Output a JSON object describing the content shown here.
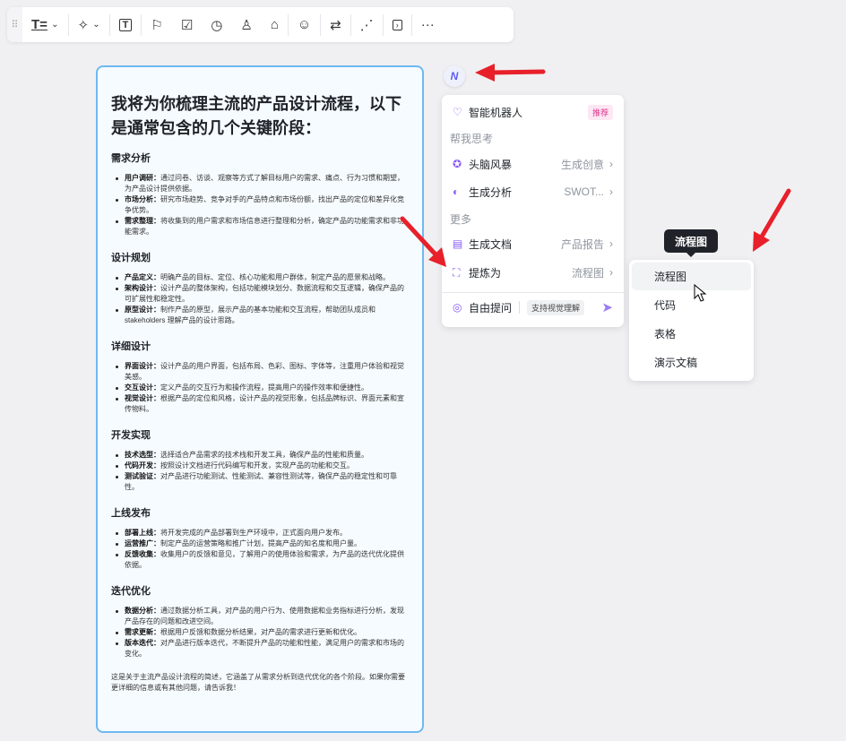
{
  "toolbar": {
    "icons": [
      "drag-handle",
      "text-style",
      "ai-magic",
      "text-box",
      "flag",
      "checkbox",
      "clock",
      "user",
      "tag",
      "emoji-add",
      "convert",
      "mindmap",
      "panel",
      "more"
    ]
  },
  "doc": {
    "title": "我将为你梳理主流的产品设计流程，以下是通常包含的几个关键阶段：",
    "sections": [
      {
        "heading": "需求分析",
        "items": [
          {
            "term": "用户调研：",
            "text": "通过问卷、访谈、观察等方式了解目标用户的需求、痛点、行为习惯和期望，为产品设计提供依据。"
          },
          {
            "term": "市场分析：",
            "text": "研究市场趋势、竞争对手的产品特点和市场份额，找出产品的定位和差异化竞争优势。"
          },
          {
            "term": "需求整理：",
            "text": "将收集到的用户需求和市场信息进行整理和分析，确定产品的功能需求和非功能需求。"
          }
        ]
      },
      {
        "heading": "设计规划",
        "items": [
          {
            "term": "产品定义：",
            "text": "明确产品的目标、定位、核心功能和用户群体，制定产品的愿景和战略。"
          },
          {
            "term": "架构设计：",
            "text": "设计产品的整体架构，包括功能模块划分、数据流程和交互逻辑，确保产品的可扩展性和稳定性。"
          },
          {
            "term": "原型设计：",
            "text": "制作产品的原型，展示产品的基本功能和交互流程，帮助团队成员和 stakeholders 理解产品的设计思路。"
          }
        ]
      },
      {
        "heading": "详细设计",
        "items": [
          {
            "term": "界面设计：",
            "text": "设计产品的用户界面，包括布局、色彩、图标、字体等，注重用户体验和视觉美感。"
          },
          {
            "term": "交互设计：",
            "text": "定义产品的交互行为和操作流程，提高用户的操作效率和便捷性。"
          },
          {
            "term": "视觉设计：",
            "text": "根据产品的定位和风格，设计产品的视觉形象，包括品牌标识、界面元素和宣传物料。"
          }
        ]
      },
      {
        "heading": "开发实现",
        "items": [
          {
            "term": "技术选型：",
            "text": "选择适合产品需求的技术栈和开发工具，确保产品的性能和质量。"
          },
          {
            "term": "代码开发：",
            "text": "按照设计文档进行代码编写和开发，实现产品的功能和交互。"
          },
          {
            "term": "测试验证：",
            "text": "对产品进行功能测试、性能测试、兼容性测试等，确保产品的稳定性和可靠性。"
          }
        ]
      },
      {
        "heading": "上线发布",
        "items": [
          {
            "term": "部署上线：",
            "text": "将开发完成的产品部署到生产环境中，正式面向用户发布。"
          },
          {
            "term": "运营推广：",
            "text": "制定产品的运营策略和推广计划，提高产品的知名度和用户量。"
          },
          {
            "term": "反馈收集：",
            "text": "收集用户的反馈和意见，了解用户的使用体验和需求，为产品的迭代优化提供依据。"
          }
        ]
      },
      {
        "heading": "迭代优化",
        "items": [
          {
            "term": "数据分析：",
            "text": "通过数据分析工具，对产品的用户行为、使用数据和业务指标进行分析，发现产品存在的问题和改进空间。"
          },
          {
            "term": "需求更新：",
            "text": "根据用户反馈和数据分析结果，对产品的需求进行更新和优化。"
          },
          {
            "term": "版本迭代：",
            "text": "对产品进行版本迭代，不断提升产品的功能和性能，满足用户的需求和市场的变化。"
          }
        ]
      }
    ],
    "footer": "这是关于主流产品设计流程的简述，它涵盖了从需求分析到迭代优化的各个阶段。如果你需要更详细的信息或有其他问题，请告诉我！"
  },
  "ai_button": "N",
  "menu": {
    "robot": "智能机器人",
    "robot_badge": "推荐",
    "group1": "帮我思考",
    "brainstorm": "头脑风暴",
    "brainstorm_val": "生成创意",
    "analysis": "生成分析",
    "analysis_val": "SWOT...",
    "group2": "更多",
    "doc": "生成文档",
    "doc_val": "产品报告",
    "extract": "提炼为",
    "extract_val": "流程图",
    "ask": "自由提问",
    "ask_tag": "支持视觉理解"
  },
  "submenu": {
    "tooltip": "流程图",
    "items": [
      "流程图",
      "代码",
      "表格",
      "演示文稿"
    ]
  },
  "colors": {
    "accent": "#8a5cf6",
    "arrow": "#e8202a",
    "card_border": "#6db9f2"
  }
}
